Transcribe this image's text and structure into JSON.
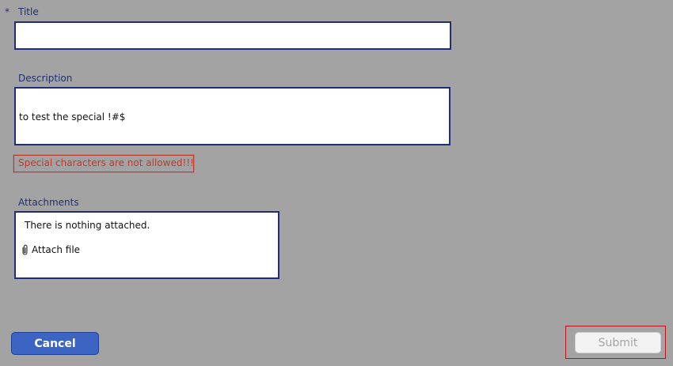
{
  "form": {
    "required_marker": "*",
    "title": {
      "label": "Title",
      "value": ""
    },
    "description": {
      "label": "Description",
      "value": "to test the special !#$"
    },
    "validation_error": "Special characters are not allowed!!!",
    "attachments": {
      "label": "Attachments",
      "empty_message": "There is nothing attached.",
      "attach_label": "Attach file"
    }
  },
  "actions": {
    "cancel_label": "Cancel",
    "submit_label": "Submit"
  }
}
